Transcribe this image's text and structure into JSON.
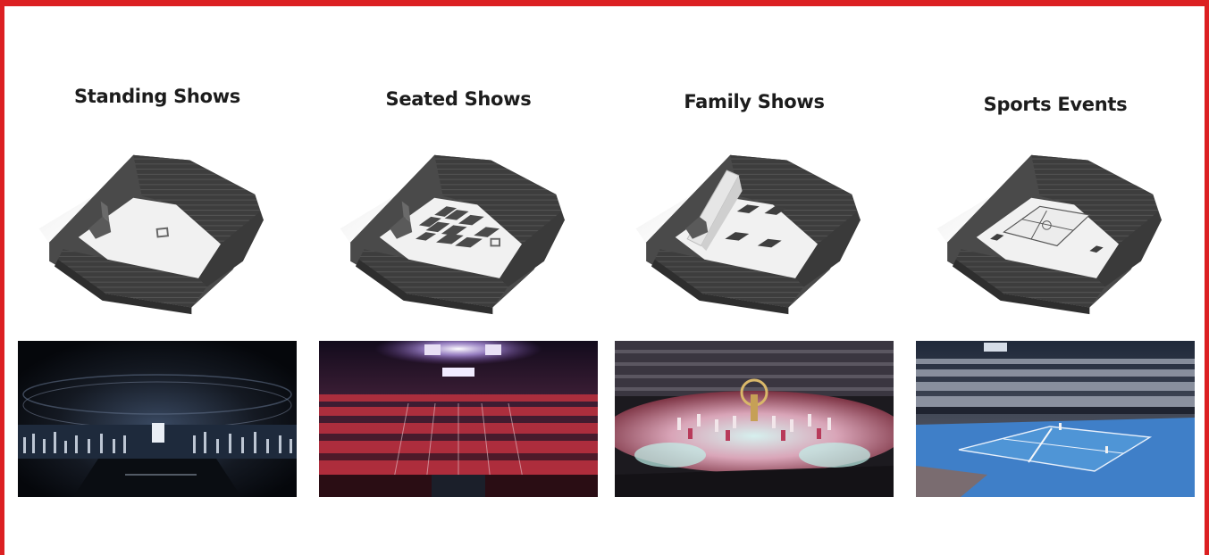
{
  "categories": [
    {
      "title": "Standing Shows"
    },
    {
      "title": "Seated Shows"
    },
    {
      "title": "Family Shows"
    },
    {
      "title": "Sports Events"
    }
  ],
  "colors": {
    "border": "#dc2022",
    "text": "#1c1c1c"
  }
}
